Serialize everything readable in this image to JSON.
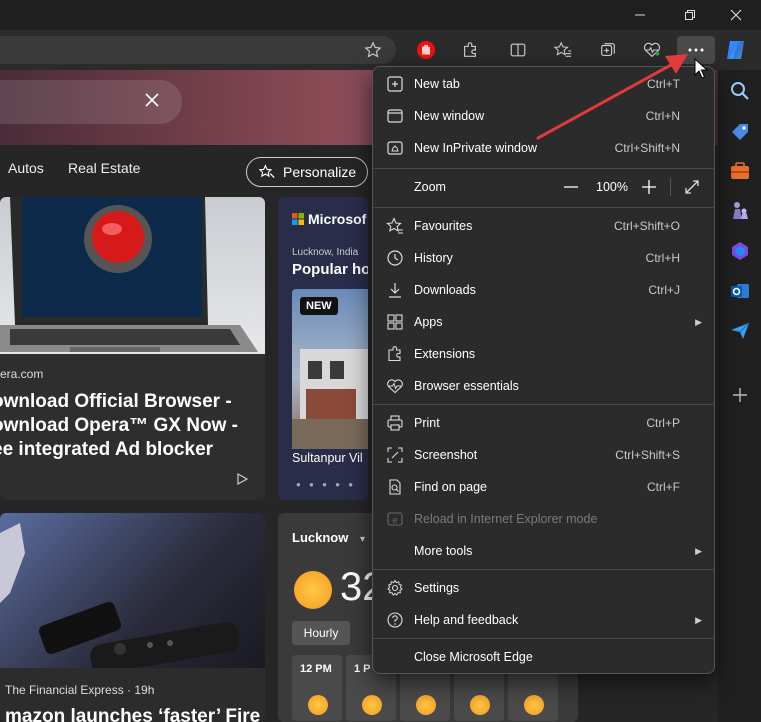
{
  "window": {
    "minimize_icon": "minimize-icon",
    "restore_icon": "restore-icon",
    "close_icon": "close-icon"
  },
  "toolbar": {
    "icons": [
      "favorite-star-icon",
      "adblock-hand-icon",
      "extensions-icon",
      "split-screen-icon",
      "favorites-icon",
      "collections-icon",
      "health-icon",
      "more-icon",
      "copilot-icon"
    ]
  },
  "page": {
    "nav": [
      "Autos",
      "Real Estate"
    ],
    "personalize_label": "Personalize",
    "card1": {
      "source": "era.com",
      "headline_lines": [
        "ownload Official Browser -",
        "ownload Opera™ GX Now -",
        "ee integrated Ad blocker"
      ]
    },
    "card2": {
      "brand": "Microsof",
      "location": "Lucknow, India",
      "title": "Popular ho",
      "badge": "NEW",
      "city": "Sultanpur Vil"
    },
    "card3": {
      "source": "The Financial Express · 19h",
      "headline": "mazon launches ‘faster’ Fire"
    },
    "weather": {
      "city": "Lucknow",
      "temp": "32",
      "tab": "Hourly",
      "hours": [
        "12 PM",
        "1 P",
        "",
        "",
        ""
      ]
    }
  },
  "menu": {
    "items": [
      {
        "label": "New tab",
        "shortcut": "Ctrl+T",
        "icon": "new-tab-icon"
      },
      {
        "label": "New window",
        "shortcut": "Ctrl+N",
        "icon": "new-window-icon"
      },
      {
        "label": "New InPrivate window",
        "shortcut": "Ctrl+Shift+N",
        "icon": "inprivate-icon"
      },
      {
        "label": "Zoom",
        "shortcut": "",
        "icon": ""
      },
      {
        "label": "Favourites",
        "shortcut": "Ctrl+Shift+O",
        "icon": "favourites-icon"
      },
      {
        "label": "History",
        "shortcut": "Ctrl+H",
        "icon": "history-icon"
      },
      {
        "label": "Downloads",
        "shortcut": "Ctrl+J",
        "icon": "downloads-icon"
      },
      {
        "label": "Apps",
        "shortcut": "",
        "icon": "apps-icon"
      },
      {
        "label": "Extensions",
        "shortcut": "",
        "icon": "extensions-icon"
      },
      {
        "label": "Browser essentials",
        "shortcut": "",
        "icon": "browser-essentials-icon"
      },
      {
        "label": "Print",
        "shortcut": "Ctrl+P",
        "icon": "print-icon"
      },
      {
        "label": "Screenshot",
        "shortcut": "Ctrl+Shift+S",
        "icon": "screenshot-icon"
      },
      {
        "label": "Find on page",
        "shortcut": "Ctrl+F",
        "icon": "find-icon"
      },
      {
        "label": "Reload in Internet Explorer mode",
        "shortcut": "",
        "icon": "ie-mode-icon"
      },
      {
        "label": "More tools",
        "shortcut": "",
        "icon": ""
      },
      {
        "label": "Settings",
        "shortcut": "",
        "icon": "settings-icon"
      },
      {
        "label": "Help and feedback",
        "shortcut": "",
        "icon": "help-icon"
      },
      {
        "label": "Close Microsoft Edge",
        "shortcut": "",
        "icon": ""
      }
    ],
    "zoom": {
      "value": "100%",
      "minus": "—",
      "plus": "+"
    }
  },
  "colors": {
    "accent_arrow": "#e03a3a",
    "menu_bg": "#2b2b2b"
  }
}
